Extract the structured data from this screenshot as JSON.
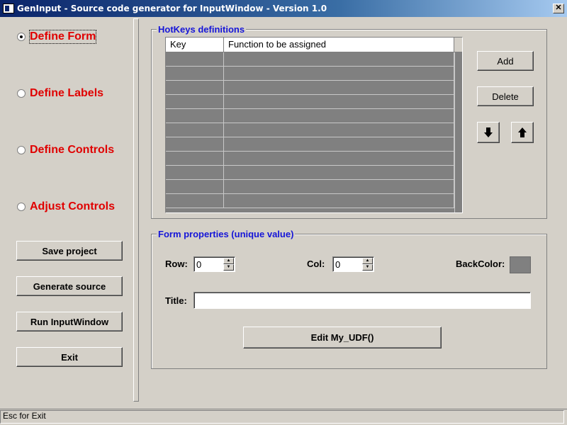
{
  "window": {
    "title": "GenInput - Source code generator for InputWindow - Version 1.0",
    "close_glyph": "✕"
  },
  "nav": {
    "radios": [
      {
        "label": "Define Form",
        "checked": true
      },
      {
        "label": "Define Labels",
        "checked": false
      },
      {
        "label": "Define Controls",
        "checked": false
      },
      {
        "label": "Adjust Controls",
        "checked": false
      }
    ],
    "buttons": [
      {
        "label": "Save project"
      },
      {
        "label": "Generate source"
      },
      {
        "label": "Run InputWindow"
      },
      {
        "label": "Exit"
      }
    ]
  },
  "hotkeys": {
    "group_title": "HotKeys definitions",
    "columns": [
      "Key",
      "Function to be assigned"
    ],
    "row_count": 11,
    "add_label": "Add",
    "delete_label": "Delete"
  },
  "form_props": {
    "group_title": "Form properties (unique value)",
    "row_label": "Row:",
    "row_value": "0",
    "col_label": "Col:",
    "col_value": "0",
    "backcolor_label": "BackColor:",
    "backcolor": "#808080",
    "title_label": "Title:",
    "title_value": "",
    "edit_udf_label": "Edit My_UDF()"
  },
  "status": {
    "text": "Esc for Exit"
  },
  "colors": {
    "accent_red": "#e00000",
    "group_blue": "#1515d8",
    "title_bar": "#0a246a"
  }
}
